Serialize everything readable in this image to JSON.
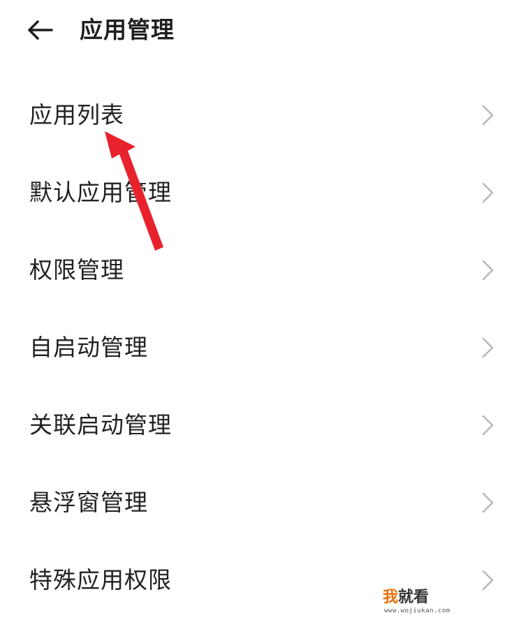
{
  "header": {
    "back_icon": "arrow-left-icon",
    "title": "应用管理"
  },
  "list": {
    "chevron_icon": "chevron-right-icon",
    "items": [
      {
        "label": "应用列表"
      },
      {
        "label": "默认应用管理"
      },
      {
        "label": "权限管理"
      },
      {
        "label": "自启动管理"
      },
      {
        "label": "关联启动管理"
      },
      {
        "label": "悬浮窗管理"
      },
      {
        "label": "特殊应用权限"
      }
    ]
  },
  "annotation": {
    "arrow_color": "#e8222c",
    "icon": "red-arrow-annotation"
  },
  "watermark": {
    "accent": "我",
    "rest": "就看",
    "url": "www.wojiukan.com",
    "accent_color": "#e8710a"
  },
  "colors": {
    "background": "#ffffff",
    "text": "#222222",
    "chevron": "#b8b8b8"
  }
}
